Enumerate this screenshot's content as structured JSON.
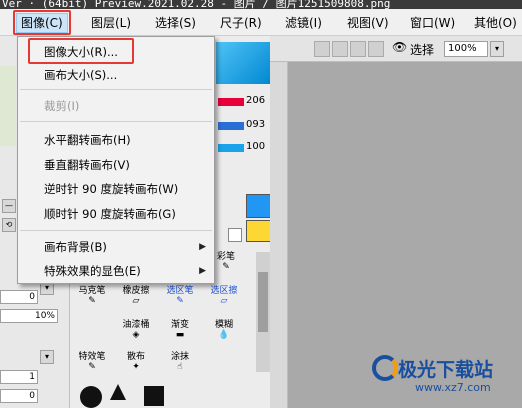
{
  "titlebar": {
    "text": "Ver · (64bit) Preview.2021.02.28 - 图片 / 图片1251509808.png"
  },
  "menubar": {
    "items": [
      {
        "label": "图像(C)",
        "active": true
      },
      {
        "label": "图层(L)"
      },
      {
        "label": "选择(S)"
      },
      {
        "label": "尺子(R)"
      },
      {
        "label": "滤镜(I)"
      },
      {
        "label": "视图(V)"
      },
      {
        "label": "窗口(W)"
      },
      {
        "label": "其他(O)"
      }
    ]
  },
  "dropdown": {
    "items": [
      {
        "label": "图像大小(R)...",
        "highlighted": true
      },
      {
        "label": "画布大小(S)..."
      },
      {
        "label": "裁剪(I)",
        "disabled": true
      },
      {
        "label": "水平翻转画布(H)"
      },
      {
        "label": "垂直翻转画布(V)"
      },
      {
        "label": "逆时针 90 度旋转画布(W)"
      },
      {
        "label": "顺时针 90 度旋转画布(G)"
      },
      {
        "label": "画布背景(B)",
        "submenu": true
      },
      {
        "label": "特殊效果的显色(E)",
        "submenu": true
      }
    ]
  },
  "right_toolbar": {
    "select_label": "选择",
    "zoom_value": "100%"
  },
  "color_sliders": [
    {
      "value": "206",
      "color": "#e8003a"
    },
    {
      "value": "093",
      "color": "#2a6fd6"
    },
    {
      "value": "100",
      "color": "#1aa3e8"
    }
  ],
  "tools": [
    {
      "label": "马克笔"
    },
    {
      "label": "橡皮擦"
    },
    {
      "label": "选区笔"
    },
    {
      "label": "选区擦"
    },
    {
      "label": "油漆桶"
    },
    {
      "label": "渐变"
    },
    {
      "label": "模糊"
    },
    {
      "label": "特效笔"
    },
    {
      "label": "散布"
    },
    {
      "label": "涂抹"
    },
    {
      "label": "彩笔"
    }
  ],
  "left_values": {
    "v1": "0",
    "v2": "10%",
    "v3": "1",
    "v4": "0"
  },
  "colors": {
    "menu_active_bg": "#cce4f7",
    "highlight_red": "#e53935",
    "primary_blue": "#2196f3",
    "secondary_yellow": "#fdd835"
  },
  "watermark": {
    "text": "极光下载站",
    "url": "www.xz7.com"
  }
}
